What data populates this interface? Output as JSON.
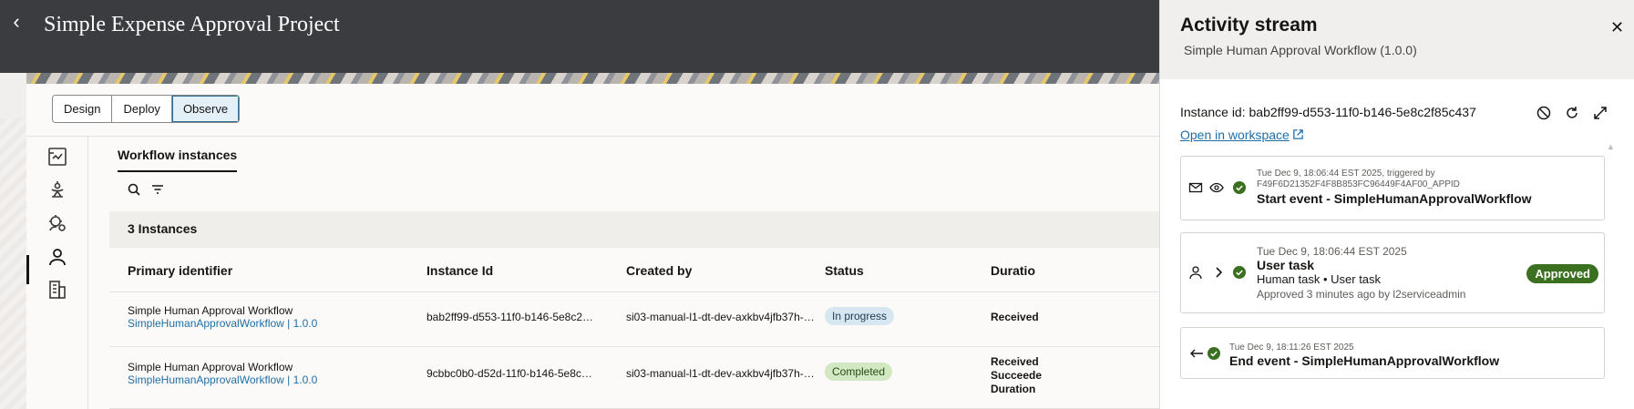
{
  "header": {
    "back_icon": "chevron-left-icon",
    "title": "Simple Expense Approval Project"
  },
  "mode_switch": {
    "items": [
      "Design",
      "Deploy",
      "Observe"
    ],
    "active": "Observe"
  },
  "side_nav": {
    "items": [
      "diagram-icon",
      "robot-arm-icon",
      "process-settings-icon",
      "person-icon",
      "building-icon"
    ],
    "active": "person-icon"
  },
  "tabs": {
    "workflow_instances": "Workflow instances"
  },
  "toolbar": {
    "search_icon": "search-icon",
    "filter_icon": "filter-icon"
  },
  "instances_count": "3 Instances",
  "table": {
    "columns": [
      "Primary identifier",
      "Instance Id",
      "Created by",
      "Status",
      "Duratio"
    ],
    "rows": [
      {
        "name": "Simple Human Approval Workflow",
        "link": "SimpleHumanApprovalWorkflow | 1.0.0",
        "instance_id": "bab2ff99-d553-11f0-b146-5e8c2…",
        "created_by": "si03-manual-l1-dt-dev-axkbv4jfb37h-…",
        "status": "In progress",
        "duration_lines": [
          "Received"
        ]
      },
      {
        "name": "Simple Human Approval Workflow",
        "link": "SimpleHumanApprovalWorkflow | 1.0.0",
        "instance_id": "9cbbc0b0-d52d-11f0-b146-5e8c…",
        "created_by": "si03-manual-l1-dt-dev-axkbv4jfb37h-…",
        "status": "Completed",
        "duration_lines": [
          "Received",
          "Succeede",
          "Duration"
        ]
      }
    ]
  },
  "panel": {
    "title": "Activity stream",
    "subtitle": "Simple Human Approval Workflow (1.0.0)",
    "close_icon": "close-icon",
    "instance_label": "Instance id:",
    "instance_value": "bab2ff99-d553-11f0-b146-5e8c2f85c437",
    "action_icons": [
      "cancel-icon",
      "refresh-icon",
      "expand-icon"
    ],
    "open_link": "Open in workspace",
    "events": [
      {
        "meta": "Tue Dec 9, 18:06:44 EST 2025, triggered by",
        "meta2": "F49F6D21352F4F8B853FC96449F4AF00_APPID",
        "name": "Start event - SimpleHumanApprovalWorkflow",
        "icons": [
          "mail-icon",
          "eye-icon",
          "check-circle-icon"
        ]
      },
      {
        "meta": "Tue Dec 9, 18:06:44 EST 2025",
        "name": "User task",
        "detail": "Human task • User task",
        "note": "Approved 3 minutes ago by l2serviceadmin",
        "badge": "Approved",
        "icons": [
          "person-icon",
          "chevron-right-icon",
          "check-circle-icon"
        ]
      },
      {
        "meta": "Tue Dec 9, 18:11:26 EST 2025",
        "name": "End event - SimpleHumanApprovalWorkflow",
        "icons": [
          "arrow-left-icon",
          "check-circle-icon"
        ]
      }
    ]
  },
  "colors": {
    "header_bg": "#3a3c3f",
    "link": "#1e6fa8",
    "success": "#3c7021",
    "in_progress_bg": "#d7e7f1",
    "completed_bg": "#d2e8c3"
  }
}
